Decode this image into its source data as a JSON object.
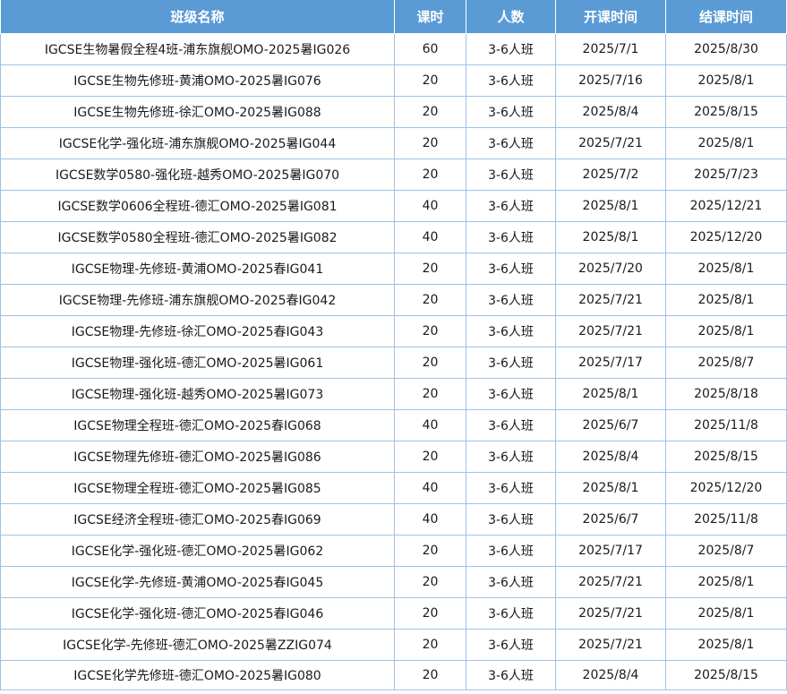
{
  "headers": {
    "name": "班级名称",
    "hours": "课时",
    "size": "人数",
    "start": "开课时间",
    "end": "结课时间"
  },
  "rows": [
    {
      "name": "IGCSE生物暑假全程4班-浦东旗舰OMO-2025暑IG026",
      "hours": "60",
      "size": "3-6人班",
      "start": "2025/7/1",
      "end": "2025/8/30"
    },
    {
      "name": "IGCSE生物先修班-黄浦OMO-2025暑IG076",
      "hours": "20",
      "size": "3-6人班",
      "start": "2025/7/16",
      "end": "2025/8/1"
    },
    {
      "name": "IGCSE生物先修班-徐汇OMO-2025暑IG088",
      "hours": "20",
      "size": "3-6人班",
      "start": "2025/8/4",
      "end": "2025/8/15"
    },
    {
      "name": "IGCSE化学-强化班-浦东旗舰OMO-2025暑IG044",
      "hours": "20",
      "size": "3-6人班",
      "start": "2025/7/21",
      "end": "2025/8/1"
    },
    {
      "name": "IGCSE数学0580-强化班-越秀OMO-2025暑IG070",
      "hours": "20",
      "size": "3-6人班",
      "start": "2025/7/2",
      "end": "2025/7/23"
    },
    {
      "name": "IGCSE数学0606全程班-德汇OMO-2025暑IG081",
      "hours": "40",
      "size": "3-6人班",
      "start": "2025/8/1",
      "end": "2025/12/21"
    },
    {
      "name": "IGCSE数学0580全程班-德汇OMO-2025暑IG082",
      "hours": "40",
      "size": "3-6人班",
      "start": "2025/8/1",
      "end": "2025/12/20"
    },
    {
      "name": "IGCSE物理-先修班-黄浦OMO-2025春IG041",
      "hours": "20",
      "size": "3-6人班",
      "start": "2025/7/20",
      "end": "2025/8/1"
    },
    {
      "name": "IGCSE物理-先修班-浦东旗舰OMO-2025春IG042",
      "hours": "20",
      "size": "3-6人班",
      "start": "2025/7/21",
      "end": "2025/8/1"
    },
    {
      "name": "IGCSE物理-先修班-徐汇OMO-2025春IG043",
      "hours": "20",
      "size": "3-6人班",
      "start": "2025/7/21",
      "end": "2025/8/1"
    },
    {
      "name": "IGCSE物理-强化班-德汇OMO-2025暑IG061",
      "hours": "20",
      "size": "3-6人班",
      "start": "2025/7/17",
      "end": "2025/8/7"
    },
    {
      "name": "IGCSE物理-强化班-越秀OMO-2025暑IG073",
      "hours": "20",
      "size": "3-6人班",
      "start": "2025/8/1",
      "end": "2025/8/18"
    },
    {
      "name": "IGCSE物理全程班-德汇OMO-2025春IG068",
      "hours": "40",
      "size": "3-6人班",
      "start": "2025/6/7",
      "end": "2025/11/8"
    },
    {
      "name": "IGCSE物理先修班-德汇OMO-2025暑IG086",
      "hours": "20",
      "size": "3-6人班",
      "start": "2025/8/4",
      "end": "2025/8/15"
    },
    {
      "name": "IGCSE物理全程班-德汇OMO-2025暑IG085",
      "hours": "40",
      "size": "3-6人班",
      "start": "2025/8/1",
      "end": "2025/12/20"
    },
    {
      "name": "IGCSE经济全程班-德汇OMO-2025春IG069",
      "hours": "40",
      "size": "3-6人班",
      "start": "2025/6/7",
      "end": "2025/11/8"
    },
    {
      "name": "IGCSE化学-强化班-德汇OMO-2025暑IG062",
      "hours": "20",
      "size": "3-6人班",
      "start": "2025/7/17",
      "end": "2025/8/7"
    },
    {
      "name": "IGCSE化学-先修班-黄浦OMO-2025春IG045",
      "hours": "20",
      "size": "3-6人班",
      "start": "2025/7/21",
      "end": "2025/8/1"
    },
    {
      "name": "IGCSE化学-强化班-德汇OMO-2025春IG046",
      "hours": "20",
      "size": "3-6人班",
      "start": "2025/7/21",
      "end": "2025/8/1"
    },
    {
      "name": "IGCSE化学-先修班-德汇OMO-2025暑ZZIG074",
      "hours": "20",
      "size": "3-6人班",
      "start": "2025/7/21",
      "end": "2025/8/1"
    },
    {
      "name": "IGCSE化学先修班-德汇OMO-2025暑IG080",
      "hours": "20",
      "size": "3-6人班",
      "start": "2025/8/4",
      "end": "2025/8/15"
    }
  ],
  "colors": {
    "header_bg": "#5b9bd5",
    "header_text": "#ffffff",
    "grid_line": "#9dc3e6",
    "cell_text": "#1a1a1a"
  }
}
